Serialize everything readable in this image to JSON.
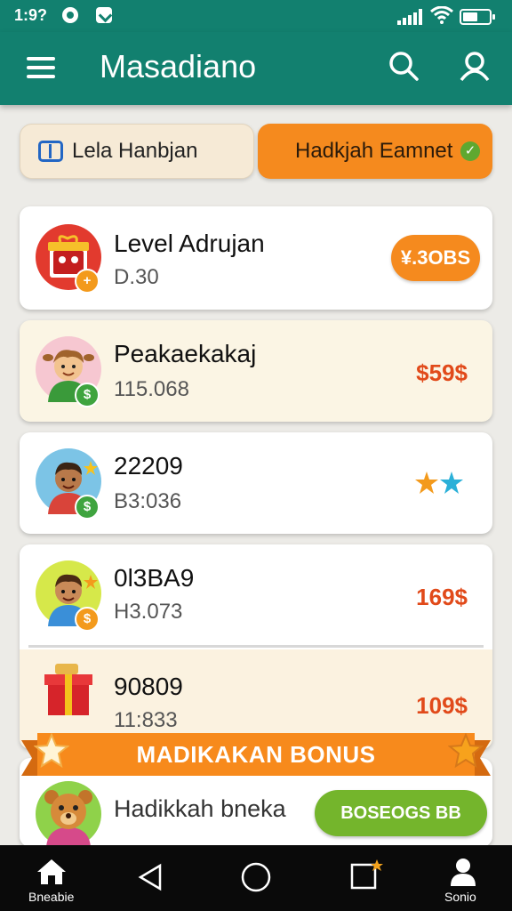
{
  "status_bar": {
    "time": "1:9?"
  },
  "app_bar": {
    "title": "Masadiano",
    "icons": [
      "menu-icon",
      "search-icon",
      "profile-icon"
    ]
  },
  "tabs": [
    {
      "label": "Lela Hanbjan",
      "icon": "number-icon",
      "active": false
    },
    {
      "label": "Hadkjah Eamnet",
      "icon": "check-icon",
      "active": true
    }
  ],
  "items": [
    {
      "title": "Level Adrujan",
      "subtitle": "D.30",
      "price": "¥.3OBS",
      "avatar": "gift-box-avatar",
      "badge": "+"
    },
    {
      "title": "Peakaekakaj",
      "subtitle": "115.068",
      "price": "$59$",
      "avatar": "boy-avatar",
      "badge": "$"
    },
    {
      "title": "22209",
      "subtitle": "B3:036",
      "price": "",
      "rating_stars": 2,
      "avatar": "boy-avatar",
      "badge": "$"
    },
    {
      "title": "0Ɩ3BA9",
      "subtitle": "H3.073",
      "price": "169$",
      "avatar": "boy-avatar",
      "badge": "$"
    },
    {
      "title": "90809",
      "subtitle": "11:833",
      "price": "109$",
      "avatar": "gift-box"
    }
  ],
  "bonus": {
    "banner_label": "MADIKAKAN BONUS",
    "row_title": "Hadikkah bneka",
    "button_label": "BOSEOGS BB",
    "avatar": "bear-avatar"
  },
  "nav_bar": {
    "left_label": "Bneabie",
    "right_label": "Sonio",
    "icons": [
      "home-icon",
      "back-icon",
      "circle-home-icon",
      "recents-icon",
      "user-icon"
    ]
  },
  "colors": {
    "primary": "#12806f",
    "accent_orange": "#f58a1e",
    "price_red": "#e14a1a",
    "bonus_green": "#74b52c",
    "cream_card": "#fbf5e4"
  }
}
